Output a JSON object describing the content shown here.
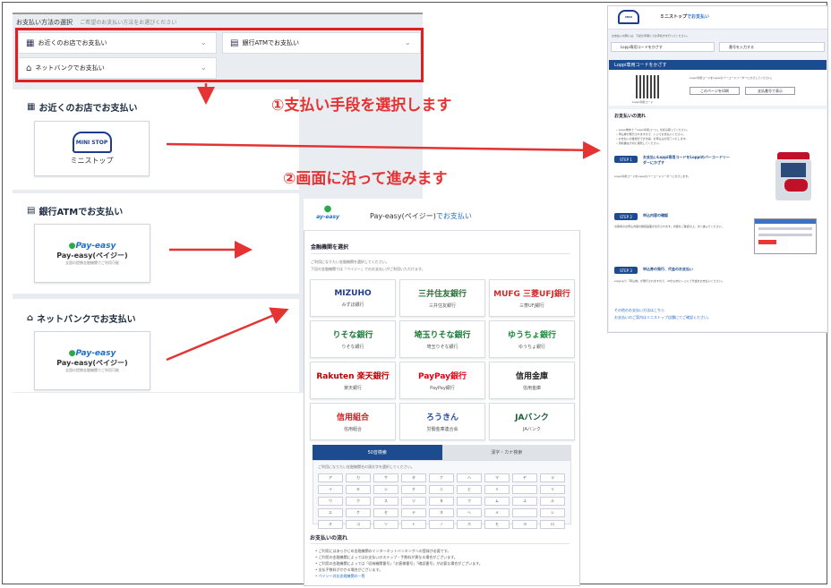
{
  "left": {
    "heading": "お支払い方法の選択",
    "subheading": "ご希望のお支払い方法をお選びください",
    "options": [
      {
        "label": "お近くのお店でお支払い",
        "icon": "store-icon"
      },
      {
        "label": "銀行ATMでお支払い",
        "icon": "atm-icon"
      },
      {
        "label": "ネットバンクでお支払い",
        "icon": "netbank-icon"
      }
    ],
    "sections": [
      {
        "title": "お近くのお店でお支払い",
        "card_logo": "MINI STOP",
        "card_label": "ミニストップ"
      },
      {
        "title": "銀行ATMでお支払い",
        "card_logo": "Pay-easy",
        "card_label": "Pay-easy(ペイジー)",
        "card_sub": "全国の提携金融機関でご利用可能"
      },
      {
        "title": "ネットバンクでお支払い",
        "card_logo": "Pay-easy",
        "card_label": "Pay-easy(ペイジー)",
        "card_sub": "全国の提携金融機関でご利用可能"
      }
    ]
  },
  "callouts": {
    "step1": "①支払い手段を選択します",
    "step2": "②画面に沿って進みます"
  },
  "middle": {
    "header_title": "Pay-easy(ペイジー)",
    "header_suffix": "でお支払い",
    "select_bank": "金融機関を選択",
    "select_note": "ご利用になりたい金融機関を選択してください。",
    "select_note2": "下記の金融機関では「ペイジー」でのお支払いがご利用いただけます。",
    "banks": [
      {
        "logo": "MIZUHO",
        "name": "みずほ銀行",
        "color": "#1d3c8f"
      },
      {
        "logo": "三井住友銀行",
        "name": "三井住友銀行",
        "color": "#2b6e3a"
      },
      {
        "logo": "MUFG 三菱UFJ銀行",
        "name": "三菱UFJ銀行",
        "color": "#d22b2b"
      },
      {
        "logo": "りそな銀行",
        "name": "りそな銀行",
        "color": "#1f7a3a"
      },
      {
        "logo": "埼玉りそな銀行",
        "name": "埼玉りそな銀行",
        "color": "#1f7a3a"
      },
      {
        "logo": "ゆうちょ銀行",
        "name": "ゆうちょ銀行",
        "color": "#1a8a3c"
      },
      {
        "logo": "Rakuten 楽天銀行",
        "name": "楽天銀行",
        "color": "#bf0000"
      },
      {
        "logo": "PayPay銀行",
        "name": "PayPay銀行",
        "color": "#e60012"
      },
      {
        "logo": "信用金庫",
        "name": "信用金庫",
        "color": "#222222"
      },
      {
        "logo": "信用組合",
        "name": "信用組合",
        "color": "#c22"
      },
      {
        "logo": "ろうきん",
        "name": "労働金庫連合会",
        "color": "#2a4fa8"
      },
      {
        "logo": "JAバンク",
        "name": "JAバンク",
        "color": "#1b5d34"
      }
    ],
    "tabs": [
      "50音検索",
      "漢字・カナ検索"
    ],
    "kana_note": "ご利用になりたい金融機関名の頭文字を選択してください。",
    "kana": [
      "ア",
      "カ",
      "サ",
      "タ",
      "ナ",
      "ハ",
      "マ",
      "ヤ",
      "ラ",
      "イ",
      "キ",
      "シ",
      "チ",
      "ニ",
      "ヒ",
      "ミ",
      "",
      "リ",
      "ウ",
      "ク",
      "ス",
      "ツ",
      "ヌ",
      "フ",
      "ム",
      "ユ",
      "ル",
      "エ",
      "ケ",
      "セ",
      "テ",
      "ネ",
      "ヘ",
      "メ",
      "",
      "レ",
      "オ",
      "コ",
      "ソ",
      "ト",
      "ノ",
      "ホ",
      "モ",
      "ヨ",
      "ロ"
    ],
    "flow_title": "お支払いの流れ",
    "flow_items": [
      "ご利用にはあらかじめ金融機関のインターネットバンキングへの登録が必要です。",
      "ご利用の金融機関によってはお支払いのステップ・手数料が異なる場合がございます。",
      "ご利用の金融機関によっては「収納機関番号」「お客様番号」「確認番号」が必要な場合がございます。",
      "支払手数料がかかる場合がございます。",
      "ペイジー対応金融機関の一覧"
    ]
  },
  "right": {
    "header_title": "ミニストップ",
    "header_suffix": "でお支払い",
    "intro": "お支払いの際には、下記の手順にてお手続きを行ってください。",
    "select1": "Loppi専用コードをかざす",
    "select2": "番号を入力する",
    "bar_title": "Loppi専用コードをかざす",
    "qr_caption": "Loppi専用コード",
    "qr_note": "Loppi専用コードをLoppiのバーコードリーダーにかざしてください。",
    "btn1": "このページを印刷",
    "btn2": "支払番号で表示",
    "flow_title": "お支払いの流れ",
    "flow_items": [
      "Loppi端末で「Loppi専用コード」を読み取ってください。",
      "申込券が発行されますので、レジでお支払いください。",
      "お支払いの確認ができ次第、お申込みが完了いたします。",
      "領収書は大切に保管してください。"
    ],
    "step1_label": "STEP 1",
    "step1_text": "お支払いLoppi専用コードをLoppiのバーコードリーダーにかざす",
    "step1_note": "Loppi専用コードをLoppiのバーコードリーダーにかざします。",
    "step2_label": "STEP 2",
    "step2_text": "申込内容の確認",
    "step2_note": "お客様のお申込内容の確認画面が表示されます。内容をご確認の上、次へ進んでください。",
    "step3_label": "STEP 3",
    "step3_text": "申込券の発行、代金のお支払い",
    "step3_note": "Loppiより「申込券」が発行されますので、30分以内にレジにて代金をお支払いください。",
    "footer1": "その他のお支払い方法はこちら",
    "footer2": "お支払いのご案内はミニストップ店舗にてご確認ください。"
  }
}
